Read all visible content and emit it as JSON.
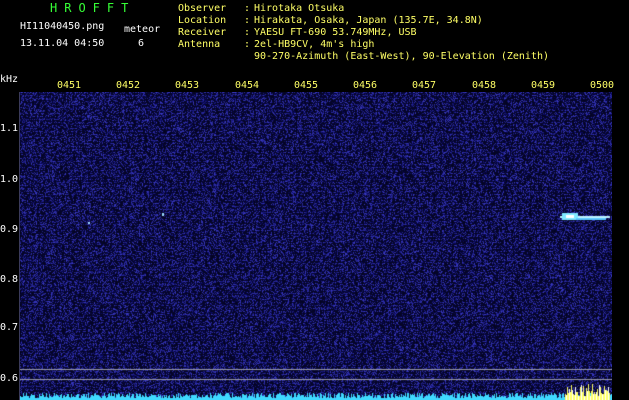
{
  "header": {
    "program_title": "HROFFT",
    "file_name": "HI11040450.png",
    "file_datetime": "13.11.04 04:50",
    "meteor_label": "meteor",
    "meteor_count": "6"
  },
  "station": {
    "rows": [
      {
        "key": "Observer",
        "value": "Hirotaka Otsuka"
      },
      {
        "key": "Location",
        "value": "Hirakata, Osaka, Japan (135.7E, 34.8N)"
      },
      {
        "key": "Receiver",
        "value": "YAESU FT-690 53.749MHz, USB"
      },
      {
        "key": "Antenna",
        "value": "2el-HB9CV, 4m's high"
      },
      {
        "key": "",
        "value": "90-270-Azimuth (East-West), 90-Elevation (Zenith)"
      }
    ]
  },
  "axes": {
    "frequency_unit": "kHz",
    "time_ticks": [
      "0451",
      "0452",
      "0453",
      "0454",
      "0455",
      "0456",
      "0457",
      "0458",
      "0459",
      "0500"
    ],
    "frequency_ticks": [
      "1.1",
      "1.0",
      "0.9",
      "0.8",
      "0.7",
      "0.6"
    ]
  },
  "colors": {
    "background": "#000000",
    "title_green": "#36ff36",
    "meta_yellow": "#ffff66",
    "label_white": "#ffffff",
    "noise_blue": "#2a2aa0",
    "signal_cyan": "#7fe9ff",
    "bottom_bar_yellow": "#ffff66"
  }
}
